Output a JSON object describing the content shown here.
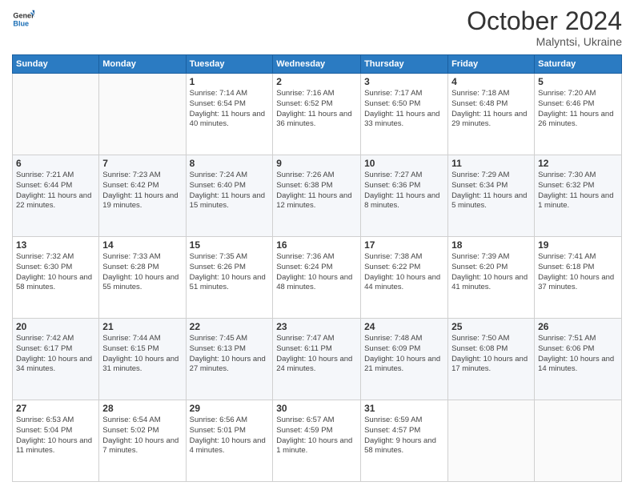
{
  "header": {
    "logo_line1": "General",
    "logo_line2": "Blue",
    "month": "October 2024",
    "location": "Malyntsi, Ukraine"
  },
  "weekdays": [
    "Sunday",
    "Monday",
    "Tuesday",
    "Wednesday",
    "Thursday",
    "Friday",
    "Saturday"
  ],
  "weeks": [
    [
      {
        "day": "",
        "info": ""
      },
      {
        "day": "",
        "info": ""
      },
      {
        "day": "1",
        "info": "Sunrise: 7:14 AM\nSunset: 6:54 PM\nDaylight: 11 hours and 40 minutes."
      },
      {
        "day": "2",
        "info": "Sunrise: 7:16 AM\nSunset: 6:52 PM\nDaylight: 11 hours and 36 minutes."
      },
      {
        "day": "3",
        "info": "Sunrise: 7:17 AM\nSunset: 6:50 PM\nDaylight: 11 hours and 33 minutes."
      },
      {
        "day": "4",
        "info": "Sunrise: 7:18 AM\nSunset: 6:48 PM\nDaylight: 11 hours and 29 minutes."
      },
      {
        "day": "5",
        "info": "Sunrise: 7:20 AM\nSunset: 6:46 PM\nDaylight: 11 hours and 26 minutes."
      }
    ],
    [
      {
        "day": "6",
        "info": "Sunrise: 7:21 AM\nSunset: 6:44 PM\nDaylight: 11 hours and 22 minutes."
      },
      {
        "day": "7",
        "info": "Sunrise: 7:23 AM\nSunset: 6:42 PM\nDaylight: 11 hours and 19 minutes."
      },
      {
        "day": "8",
        "info": "Sunrise: 7:24 AM\nSunset: 6:40 PM\nDaylight: 11 hours and 15 minutes."
      },
      {
        "day": "9",
        "info": "Sunrise: 7:26 AM\nSunset: 6:38 PM\nDaylight: 11 hours and 12 minutes."
      },
      {
        "day": "10",
        "info": "Sunrise: 7:27 AM\nSunset: 6:36 PM\nDaylight: 11 hours and 8 minutes."
      },
      {
        "day": "11",
        "info": "Sunrise: 7:29 AM\nSunset: 6:34 PM\nDaylight: 11 hours and 5 minutes."
      },
      {
        "day": "12",
        "info": "Sunrise: 7:30 AM\nSunset: 6:32 PM\nDaylight: 11 hours and 1 minute."
      }
    ],
    [
      {
        "day": "13",
        "info": "Sunrise: 7:32 AM\nSunset: 6:30 PM\nDaylight: 10 hours and 58 minutes."
      },
      {
        "day": "14",
        "info": "Sunrise: 7:33 AM\nSunset: 6:28 PM\nDaylight: 10 hours and 55 minutes."
      },
      {
        "day": "15",
        "info": "Sunrise: 7:35 AM\nSunset: 6:26 PM\nDaylight: 10 hours and 51 minutes."
      },
      {
        "day": "16",
        "info": "Sunrise: 7:36 AM\nSunset: 6:24 PM\nDaylight: 10 hours and 48 minutes."
      },
      {
        "day": "17",
        "info": "Sunrise: 7:38 AM\nSunset: 6:22 PM\nDaylight: 10 hours and 44 minutes."
      },
      {
        "day": "18",
        "info": "Sunrise: 7:39 AM\nSunset: 6:20 PM\nDaylight: 10 hours and 41 minutes."
      },
      {
        "day": "19",
        "info": "Sunrise: 7:41 AM\nSunset: 6:18 PM\nDaylight: 10 hours and 37 minutes."
      }
    ],
    [
      {
        "day": "20",
        "info": "Sunrise: 7:42 AM\nSunset: 6:17 PM\nDaylight: 10 hours and 34 minutes."
      },
      {
        "day": "21",
        "info": "Sunrise: 7:44 AM\nSunset: 6:15 PM\nDaylight: 10 hours and 31 minutes."
      },
      {
        "day": "22",
        "info": "Sunrise: 7:45 AM\nSunset: 6:13 PM\nDaylight: 10 hours and 27 minutes."
      },
      {
        "day": "23",
        "info": "Sunrise: 7:47 AM\nSunset: 6:11 PM\nDaylight: 10 hours and 24 minutes."
      },
      {
        "day": "24",
        "info": "Sunrise: 7:48 AM\nSunset: 6:09 PM\nDaylight: 10 hours and 21 minutes."
      },
      {
        "day": "25",
        "info": "Sunrise: 7:50 AM\nSunset: 6:08 PM\nDaylight: 10 hours and 17 minutes."
      },
      {
        "day": "26",
        "info": "Sunrise: 7:51 AM\nSunset: 6:06 PM\nDaylight: 10 hours and 14 minutes."
      }
    ],
    [
      {
        "day": "27",
        "info": "Sunrise: 6:53 AM\nSunset: 5:04 PM\nDaylight: 10 hours and 11 minutes."
      },
      {
        "day": "28",
        "info": "Sunrise: 6:54 AM\nSunset: 5:02 PM\nDaylight: 10 hours and 7 minutes."
      },
      {
        "day": "29",
        "info": "Sunrise: 6:56 AM\nSunset: 5:01 PM\nDaylight: 10 hours and 4 minutes."
      },
      {
        "day": "30",
        "info": "Sunrise: 6:57 AM\nSunset: 4:59 PM\nDaylight: 10 hours and 1 minute."
      },
      {
        "day": "31",
        "info": "Sunrise: 6:59 AM\nSunset: 4:57 PM\nDaylight: 9 hours and 58 minutes."
      },
      {
        "day": "",
        "info": ""
      },
      {
        "day": "",
        "info": ""
      }
    ]
  ]
}
